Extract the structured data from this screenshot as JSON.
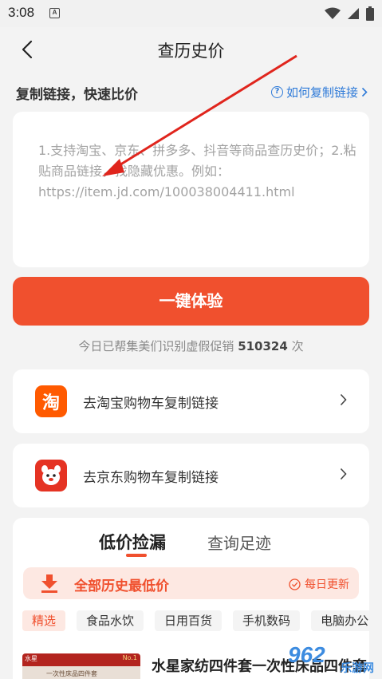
{
  "status_bar": {
    "time": "3:08",
    "notification_icon": "A"
  },
  "navbar": {
    "title": "查历史价"
  },
  "section": {
    "title": "复制链接，快速比价",
    "help_link": "如何复制链接"
  },
  "input": {
    "placeholder": "1.支持淘宝、京东、拼多多、抖音等商品查历史价；2.粘贴商品链接，找隐藏优惠。例如：https://item.jd.com/100038004411.html"
  },
  "cta_button": "一键体验",
  "stats": {
    "prefix": "今日已帮集美们识别虚假促销",
    "count": "510324",
    "suffix": "次"
  },
  "carts": {
    "taobao": {
      "icon_char": "淘",
      "label": "去淘宝购物车复制链接"
    },
    "jd": {
      "label": "去京东购物车复制链接"
    }
  },
  "deals": {
    "tabs": [
      {
        "label": "低价捡漏",
        "active": true
      },
      {
        "label": "查询足迹",
        "active": false
      }
    ],
    "banner": {
      "title": "全部历史最低价",
      "badge": "每日更新"
    },
    "categories": [
      "精选",
      "食品水饮",
      "日用百货",
      "手机数码",
      "电脑办公"
    ],
    "product": {
      "title": "水星家纺四件套一次性床品四件套",
      "thumb_brand": "水星",
      "thumb_badge": "No.1",
      "thumb_text": "一次性床品四件套"
    }
  },
  "watermark": {
    "logo": "962",
    "sub": "乐游网"
  },
  "colors": {
    "accent": "#f0502e",
    "link": "#2e7ad8",
    "taobao": "#ff5a00",
    "jd": "#e53323"
  },
  "icons": [
    "back-arrow-icon",
    "help-circle-icon",
    "chevron-right-icon",
    "wifi-icon",
    "signal-icon",
    "battery-icon",
    "download-icon",
    "check-circle-icon"
  ]
}
